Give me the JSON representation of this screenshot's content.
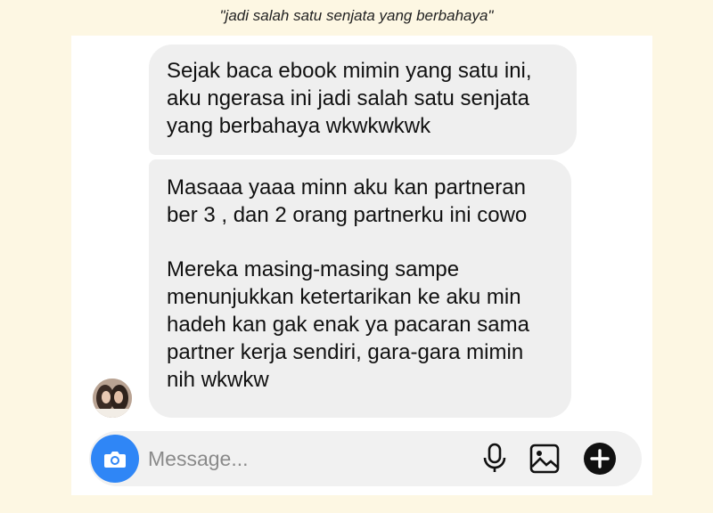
{
  "caption": "\"jadi salah satu senjata yang berbahaya\"",
  "messages": [
    {
      "text": "Sejak baca ebook mimin yang satu ini, aku ngerasa ini jadi salah satu senjata yang berbahaya wkwkwkwk"
    },
    {
      "paragraph_1": "Masaaa yaaa minn aku kan partneran ber 3 , dan 2 orang partnerku ini cowo",
      "paragraph_2": "Mereka masing-masing sampe menunjukkan ketertarikan ke aku min hadeh kan gak enak ya pacaran sama partner kerja sendiri, gara-gara mimin nih wkwkw"
    }
  ],
  "composer": {
    "placeholder": "Message...",
    "icons": [
      "camera-icon",
      "microphone-icon",
      "gallery-icon",
      "plus-icon"
    ]
  },
  "colors": {
    "page_background": "#fdf7e3",
    "bubble": "#efefef",
    "camera_button": "#2f86f6"
  }
}
